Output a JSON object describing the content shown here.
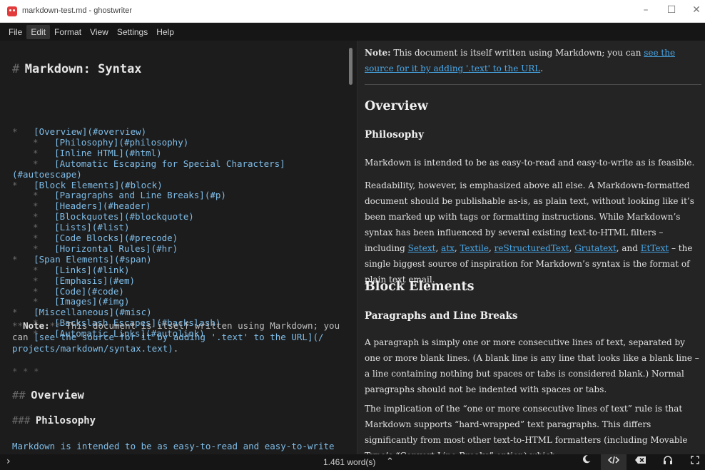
{
  "window": {
    "title": "markdown-test.md - ghostwriter",
    "minimize": "–",
    "maximize": "☐",
    "close": "✕"
  },
  "menu": [
    "File",
    "Edit",
    "Format",
    "View",
    "Settings",
    "Help"
  ],
  "editor": {
    "h1_marker": "#",
    "h1_text": "Markdown: Syntax",
    "toc": [
      {
        "indent": 0,
        "text": "[Overview](#overview)"
      },
      {
        "indent": 1,
        "text": "[Philosophy](#philosophy)"
      },
      {
        "indent": 1,
        "text": "[Inline HTML](#html)"
      },
      {
        "indent": 1,
        "text": "[Automatic Escaping for Special Characters]"
      },
      {
        "indent": -1,
        "text": "(#autoescape)"
      },
      {
        "indent": 0,
        "text": "[Block Elements](#block)"
      },
      {
        "indent": 1,
        "text": "[Paragraphs and Line Breaks](#p)"
      },
      {
        "indent": 1,
        "text": "[Headers](#header)"
      },
      {
        "indent": 1,
        "text": "[Blockquotes](#blockquote)"
      },
      {
        "indent": 1,
        "text": "[Lists](#list)"
      },
      {
        "indent": 1,
        "text": "[Code Blocks](#precode)"
      },
      {
        "indent": 1,
        "text": "[Horizontal Rules](#hr)"
      },
      {
        "indent": 0,
        "text": "[Span Elements](#span)"
      },
      {
        "indent": 1,
        "text": "[Links](#link)"
      },
      {
        "indent": 1,
        "text": "[Emphasis](#em)"
      },
      {
        "indent": 1,
        "text": "[Code](#code)"
      },
      {
        "indent": 1,
        "text": "[Images](#img)"
      },
      {
        "indent": 0,
        "text": "[Miscellaneous](#misc)"
      },
      {
        "indent": 1,
        "text": "[Backslash Escapes](#backslash)"
      },
      {
        "indent": 1,
        "text": "[Automatic Links](#autolink)"
      }
    ],
    "note_line1_pre": "**",
    "note_line1_bold": "Note:",
    "note_line1_post": "**",
    "note_line1_text": " This document is itself written using Markdown; you",
    "note_line2_text": "can ",
    "note_line2_link": "[see the source for it by adding '.text' to the URL](/",
    "note_line3_link": "projects/markdown/syntax.text)",
    "note_line3_text": ".",
    "hr": "* * *",
    "h2_marker": "##",
    "h2_text": "Overview",
    "h3_marker": "###",
    "h3_text": "Philosophy",
    "last_line": "Markdown is intended to be as easy-to-read and easy-to-write",
    "bullet": "*"
  },
  "preview": {
    "note_bold": "Note:",
    "note_text": " This document is itself written using Markdown; you can ",
    "note_link_1": "see the source for it by",
    "note_link_2": "adding '.text' to the URL",
    "note_end": ".",
    "overview": "Overview",
    "philosophy": "Philosophy",
    "p1": "Markdown is intended to be as easy-to-read and easy-to-write as is feasible.",
    "p2_a": "Readability, however, is emphasized above all else. A Markdown-formatted document should be publishable as-is, as plain text, without looking like it’s been marked up with tags or formatting instructions. While Markdown’s syntax has been influenced by several existing text-to-HTML filters – including ",
    "p2_links": [
      "Setext",
      "atx",
      "Textile",
      "reStructuredText",
      "Grutatext"
    ],
    "p2_and": "and ",
    "p2_link_last": "EtText",
    "p2_b": " – the single biggest source of inspiration for Markdown’s syntax is the format of plain text email.",
    "block_elements": "Block Elements",
    "paragraphs": "Paragraphs and Line Breaks",
    "p3": "A paragraph is simply one or more consecutive lines of text, separated by one or more blank lines. (A blank line is any line that looks like a blank line – a line containing nothing but spaces or tabs is considered blank.) Normal paragraphs should not be indented with spaces or tabs.",
    "p4": "The implication of the “one or more consecutive lines of text” rule is that Markdown supports “hard-wrapped” text paragraphs. This differs significantly from most other text-to-HTML formatters (including Movable Type’s “Convert Line Breaks” option) which"
  },
  "status": {
    "word_count": "1.461 word(s)",
    "chevron": "›",
    "wc_icon": "⌃",
    "icons": [
      "moon-icon",
      "code-icon",
      "erase-icon",
      "headphones-icon",
      "fullscreen-icon"
    ]
  }
}
